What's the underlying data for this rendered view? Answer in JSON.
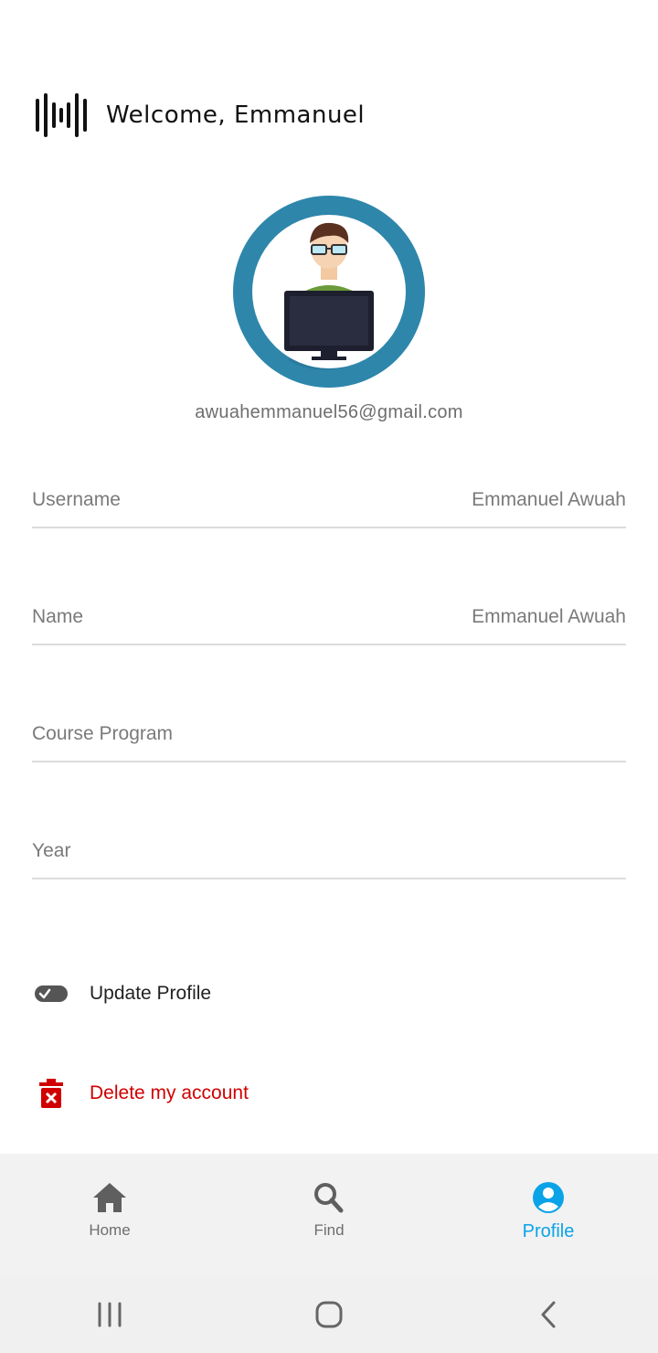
{
  "header": {
    "title": "Welcome, Emmanuel",
    "logo_icon": "sound-wave-icon"
  },
  "profile": {
    "avatar_icon": "user-at-computer-avatar",
    "email": "awuahemmanuel56@gmail.com"
  },
  "fields": [
    {
      "label": "Username",
      "value": "Emmanuel Awuah"
    },
    {
      "label": "Name",
      "value": "Emmanuel Awuah"
    },
    {
      "label": "Course Program",
      "value": ""
    },
    {
      "label": "Year",
      "value": ""
    }
  ],
  "actions": {
    "update_label": "Update Profile",
    "update_icon": "toggle-check-icon",
    "delete_label": "Delete my account",
    "delete_icon": "trash-icon",
    "delete_color": "#d10000"
  },
  "bottom_nav": {
    "items": [
      {
        "label": "Home",
        "icon": "home-icon"
      },
      {
        "label": "Find",
        "icon": "search-icon"
      },
      {
        "label": "Profile",
        "icon": "account-circle-icon"
      }
    ],
    "active": "Profile",
    "active_color": "#0aa3e8"
  },
  "system_nav": {
    "icons": [
      "recent-apps-icon",
      "home-button-icon",
      "back-icon"
    ]
  }
}
